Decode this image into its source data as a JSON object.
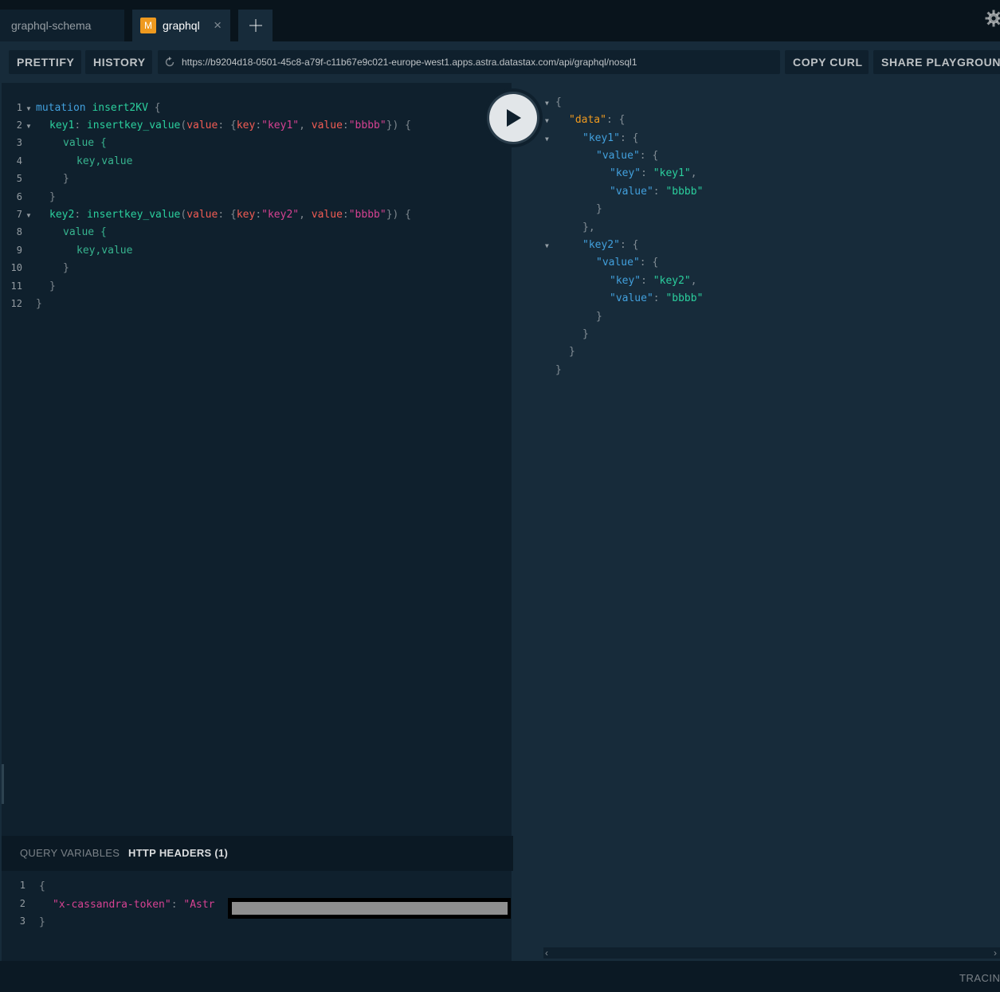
{
  "tabs": [
    {
      "label": "graphql-schema"
    },
    {
      "label": "graphql",
      "badge": "M",
      "close": "×"
    }
  ],
  "toolbar": {
    "prettify_label": "PRETTIFY",
    "history_label": "HISTORY",
    "endpoint_url": "https://b9204d18-0501-45c8-a79f-c11b67e9c021-europe-west1.apps.astra.datastax.com/api/graphql/nosql1",
    "copy_curl_label": "COPY CURL",
    "share_label": "SHARE PLAYGROUND"
  },
  "query": {
    "line_numbers": [
      "1",
      "2",
      "3",
      "4",
      "5",
      "6",
      "7",
      "8",
      "9",
      "10",
      "11",
      "12"
    ],
    "lines": [
      {
        "kw": "mutation",
        "name": "insert2KV",
        "brace": "{"
      },
      {
        "alias": "key1",
        "field": "insertkey_value",
        "argname": "value",
        "k1": "key",
        "v1": "\"key1\"",
        "k2": "value",
        "v2": "\"bbbb\"",
        "tail": "}) {"
      },
      {
        "text": "value {"
      },
      {
        "text": "key,value"
      },
      {
        "text": "}"
      },
      {
        "text": "}"
      },
      {
        "alias": "key2",
        "field": "insertkey_value",
        "argname": "value",
        "k1": "key",
        "v1": "\"key2\"",
        "k2": "value",
        "v2": "\"bbbb\"",
        "tail": "}) {"
      },
      {
        "text": "value {"
      },
      {
        "text": "key,value"
      },
      {
        "text": "}"
      },
      {
        "text": "}"
      },
      {
        "text": "}"
      }
    ]
  },
  "result": {
    "data_key": "\"data\"",
    "key1": "\"key1\"",
    "key2": "\"key2\"",
    "value_key": "\"value\"",
    "key_key": "\"key\"",
    "key1_value": "\"key1\"",
    "key2_value": "\"key2\"",
    "bbbb": "\"bbbb\""
  },
  "variables_panel": {
    "query_variables_label": "QUERY VARIABLES",
    "http_headers_label": "HTTP HEADERS (1)",
    "line_numbers": [
      "1",
      "2",
      "3"
    ],
    "open_brace": "{",
    "header_name": "\"x-cassandra-token\"",
    "header_value_prefix": "\"Astr",
    "close_brace": "}"
  },
  "footer": {
    "tracing_label": "TRACING"
  },
  "colors": {
    "background": "#0f202d",
    "result_background": "#172b3a",
    "badge": "#ef9a1f",
    "keyword": "#42a0dd",
    "string": "#d64292",
    "attribute": "#f25c54",
    "def": "#2bcf9d"
  },
  "icons": {
    "run": "play-icon",
    "reload": "reload-icon",
    "settings": "gear-icon",
    "add_tab": "plus-icon"
  }
}
